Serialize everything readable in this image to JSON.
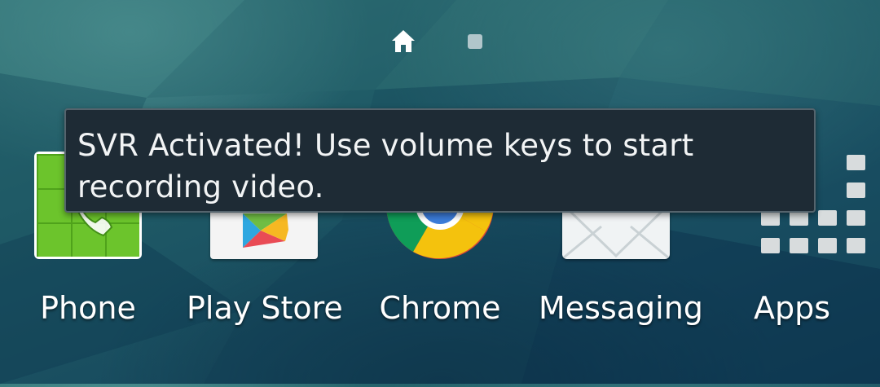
{
  "home_screen": {
    "page_indicator": {
      "pages": [
        "home-icon",
        "page-dot"
      ],
      "current_page": 1
    },
    "apps": [
      {
        "label": "Phone",
        "icon": "phone-icon"
      },
      {
        "label": "Play Store",
        "icon": "play-store-icon"
      },
      {
        "label": "Chrome",
        "icon": "chrome-icon"
      },
      {
        "label": "Messaging",
        "icon": "messaging-icon"
      },
      {
        "label": "Apps",
        "icon": "apps-grid-icon"
      }
    ]
  },
  "toast": {
    "message": "SVR Activated! Use volume keys to start recording video."
  },
  "colors": {
    "wallpaper": "#1f5a66",
    "toast_background": "#1e2b35",
    "toast_border": "#55646d",
    "phone_green": "#6cc42c",
    "label_text": "#ffffff"
  }
}
